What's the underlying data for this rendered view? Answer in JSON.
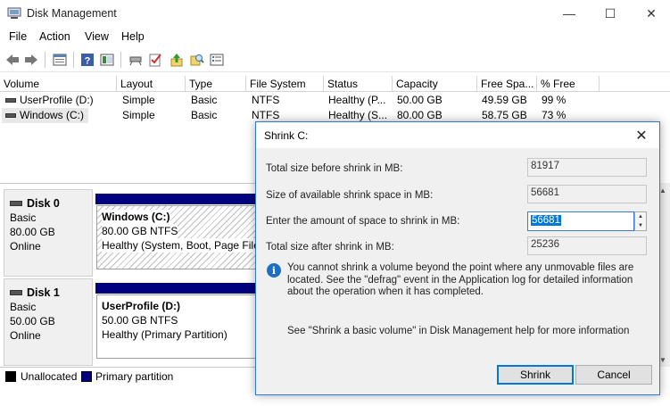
{
  "window": {
    "title": "Disk Management",
    "controls": {
      "minimize": "—",
      "maximize": "☐",
      "close": "✕"
    }
  },
  "menu": [
    "File",
    "Action",
    "View",
    "Help"
  ],
  "toolbar": {
    "icons": [
      "back-arrow-icon",
      "forward-arrow-icon",
      "properties-icon",
      "help-icon",
      "console-icon",
      "connect-icon",
      "checklist-icon",
      "upload-icon",
      "search-disk-icon",
      "list-view-icon"
    ]
  },
  "volumes": {
    "columns": [
      "Volume",
      "Layout",
      "Type",
      "File System",
      "Status",
      "Capacity",
      "Free Spa...",
      "% Free"
    ],
    "rows": [
      {
        "volume": "UserProfile (D:)",
        "layout": "Simple",
        "type": "Basic",
        "fs": "NTFS",
        "status": "Healthy (P...",
        "capacity": "50.00 GB",
        "free": "49.59 GB",
        "pct": "99 %"
      },
      {
        "volume": "Windows (C:)",
        "layout": "Simple",
        "type": "Basic",
        "fs": "NTFS",
        "status": "Healthy (S...",
        "capacity": "80.00 GB",
        "free": "58.75 GB",
        "pct": "73 %"
      }
    ]
  },
  "disks": [
    {
      "name": "Disk 0",
      "type": "Basic",
      "size": "80.00 GB",
      "state": "Online",
      "partition": {
        "name": "Windows  (C:)",
        "size_fs": "80.00 GB NTFS",
        "status": "Healthy (System, Boot, Page File"
      }
    },
    {
      "name": "Disk 1",
      "type": "Basic",
      "size": "50.00 GB",
      "state": "Online",
      "partition": {
        "name": "UserProfile  (D:)",
        "size_fs": "50.00 GB NTFS",
        "status": "Healthy (Primary Partition)"
      }
    }
  ],
  "legend": {
    "unallocated": "Unallocated",
    "primary": "Primary partition",
    "colors": {
      "unallocated": "#000000",
      "primary": "#000080"
    }
  },
  "dialog": {
    "title": "Shrink C:",
    "total_before_label": "Total size before shrink in MB:",
    "total_before_value": "81917",
    "available_label": "Size of available shrink space in MB:",
    "available_value": "56681",
    "amount_label": "Enter the amount of space to shrink in MB:",
    "amount_value": "56681",
    "total_after_label": "Total size after shrink in MB:",
    "total_after_value": "25236",
    "info_text": "You cannot shrink a volume beyond the point where any unmovable files are located. See the \"defrag\" event in the Application log for detailed information about the operation when it has completed.",
    "help_text": "See \"Shrink a basic volume\" in Disk Management help for more information",
    "shrink_button": "Shrink",
    "cancel_button": "Cancel"
  }
}
